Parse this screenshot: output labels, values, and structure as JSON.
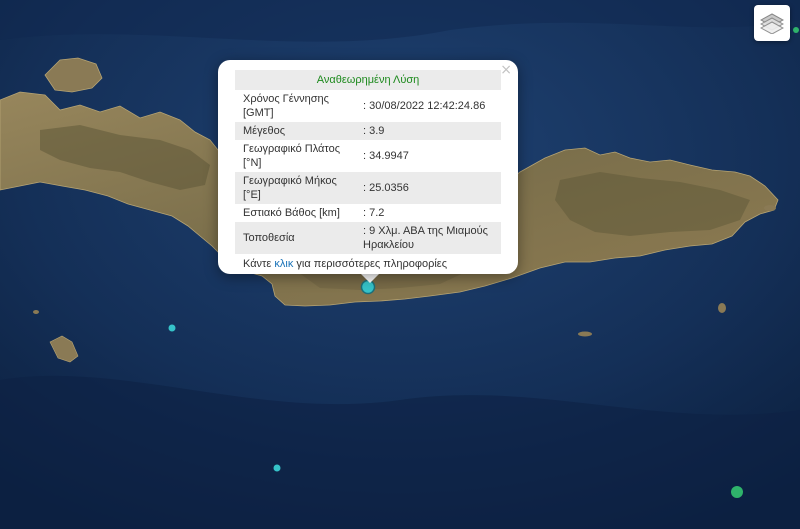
{
  "map": {
    "colors": {
      "sea_deep": "#0e2546",
      "sea_shallow": "#1d3c6a",
      "land": "#8a7a55",
      "land_dark": "#5e5838",
      "marker": "#36c3c9",
      "marker_green": "#2fb36b"
    },
    "controls": {
      "layers_icon": "layers-icon"
    }
  },
  "popup": {
    "title": "Αναθεωρημένη Λύση",
    "rows": [
      {
        "label": "Χρόνος Γέννησης [GMT]",
        "value": ": 30/08/2022 12:42:24.86"
      },
      {
        "label": "Μέγεθος",
        "value": ": 3.9"
      },
      {
        "label": "Γεωγραφικό Πλάτος [°N]",
        "value": ": 34.9947"
      },
      {
        "label": "Γεωγραφικό Μήκος [°E]",
        "value": ": 25.0356"
      },
      {
        "label": "Εστιακό Βάθος [km]",
        "value": ": 7.2"
      },
      {
        "label": "Τοποθεσία",
        "value": ": 9 Χλμ. ΑΒΑ της Μιαμούς Ηρακλείου"
      }
    ],
    "more_prefix": "Κάντε",
    "more_link": "κλικ",
    "more_suffix": "για περισσότερες πληροφορίες",
    "close": "×"
  }
}
